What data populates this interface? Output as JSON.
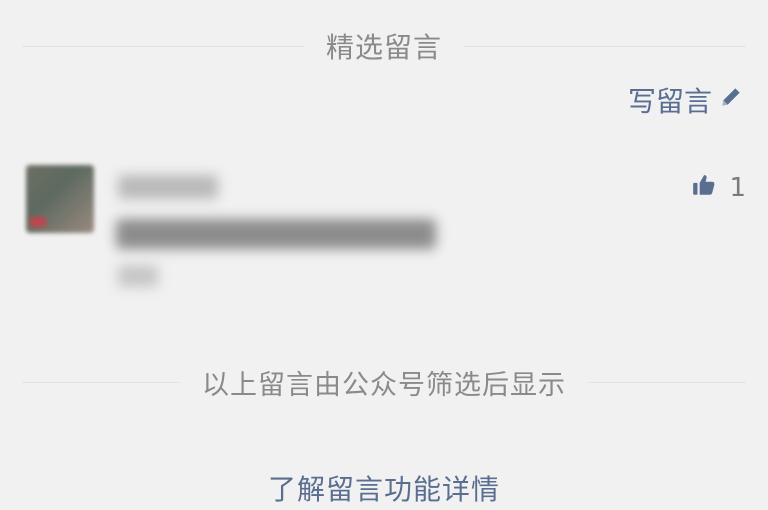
{
  "header": {
    "title": "精选留言"
  },
  "write_comment": {
    "label": "写留言",
    "icon": "pencil-icon"
  },
  "comment": {
    "like_icon": "thumbs-up-icon",
    "like_count": "1"
  },
  "footer": {
    "note": "以上留言由公众号筛选后显示",
    "link_label": "了解留言功能详情"
  },
  "colors": {
    "background": "#f1f1f1",
    "link": "#5a6e91",
    "muted_text": "#8a8a8a",
    "divider": "#e3e3e3"
  }
}
